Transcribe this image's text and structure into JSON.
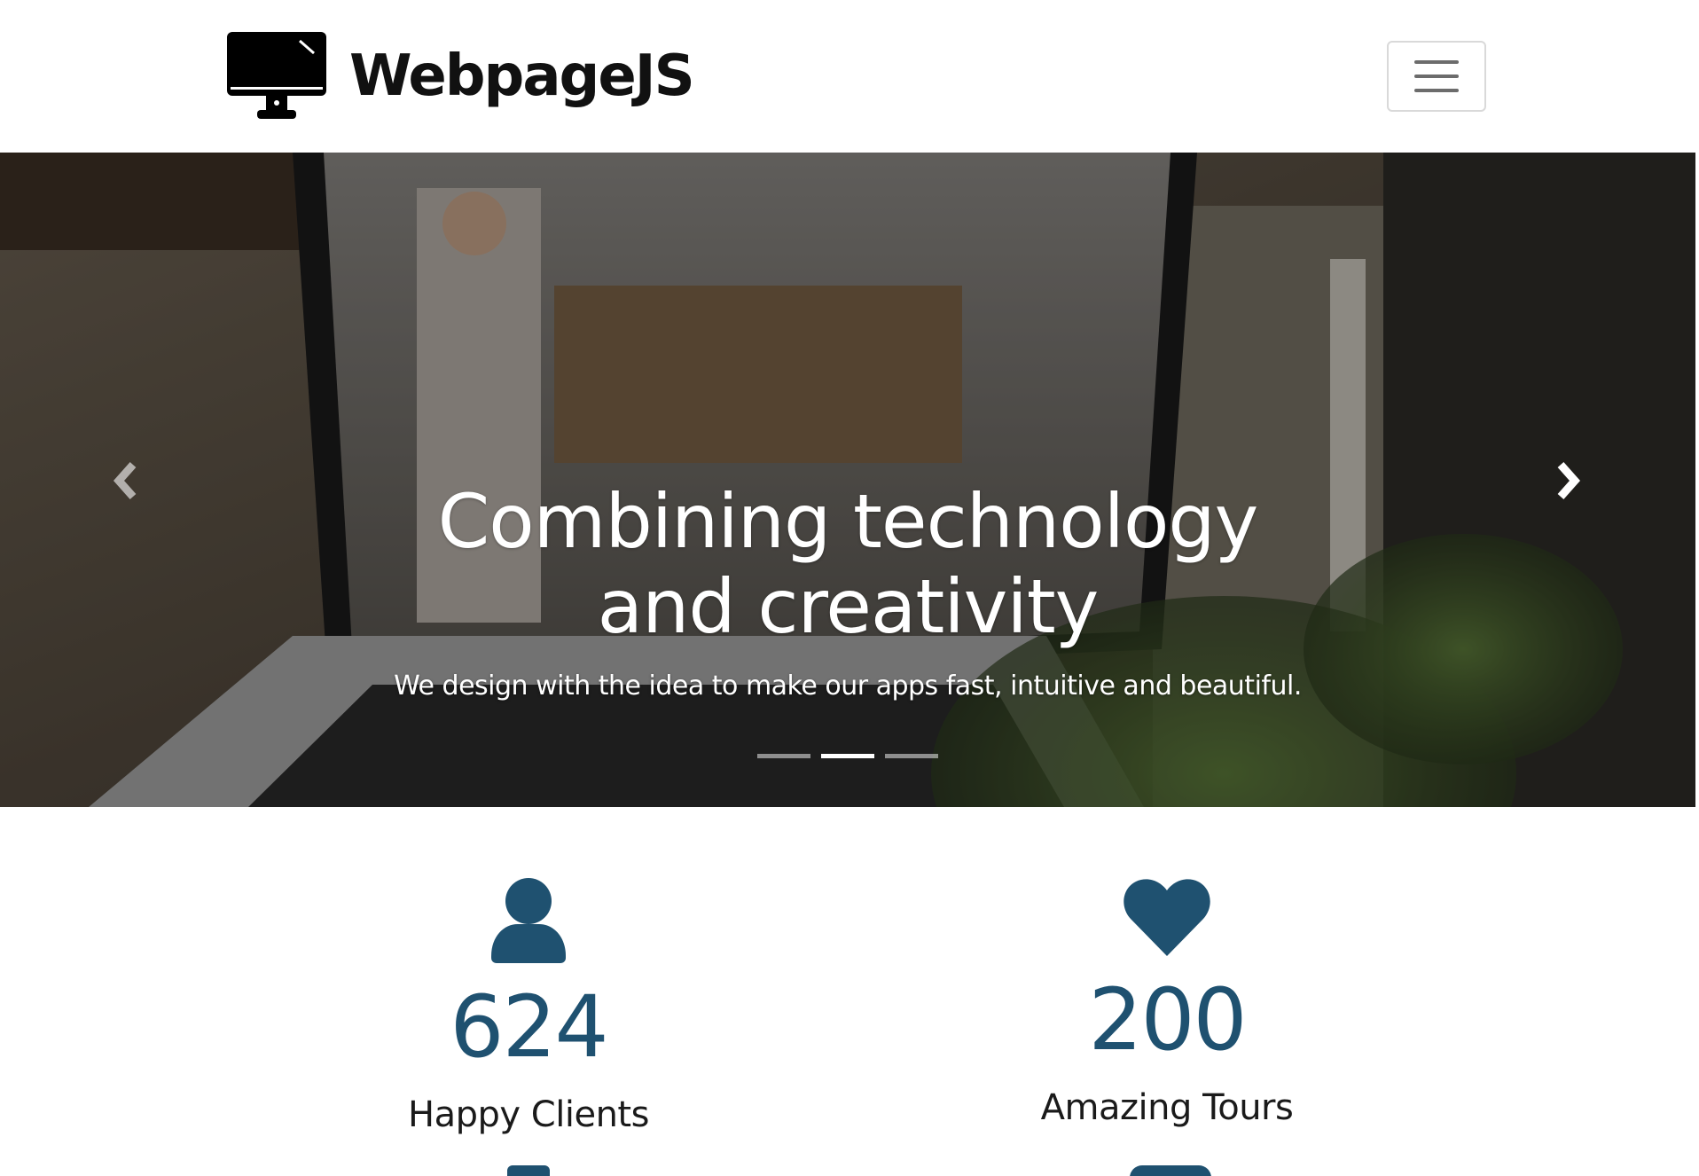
{
  "navbar": {
    "brand_name": "WebpageJS",
    "brand_icon": "desktop-monitor-icon",
    "toggle_icon": "hamburger-menu-icon"
  },
  "hero": {
    "heading": "Combining technology and creativity",
    "subheading": "We design with the idea to make our apps fast, intuitive and beautiful.",
    "slide_count": 3,
    "active_slide": 2,
    "prev_icon": "chevron-left-icon",
    "next_icon": "chevron-right-icon"
  },
  "stats": [
    {
      "icon": "user-icon",
      "value": "624",
      "label": "Happy Clients"
    },
    {
      "icon": "heart-icon",
      "value": "200",
      "label": "Amazing Tours"
    }
  ],
  "colors": {
    "accent": "#1f5170",
    "text": "#1a1a1a",
    "brand": "#111111"
  }
}
